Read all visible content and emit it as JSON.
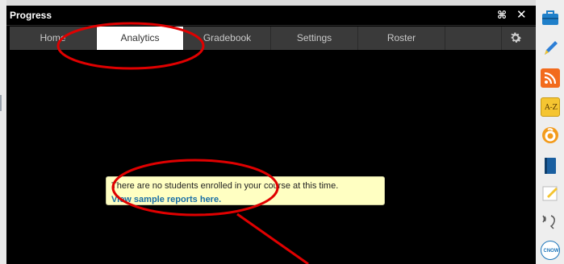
{
  "window": {
    "title": "Progress",
    "collapse_icon": "collapse-icon",
    "close_icon": "close-icon"
  },
  "tabs": [
    {
      "label": "Home",
      "active": false
    },
    {
      "label": "Analytics",
      "active": true
    },
    {
      "label": "Gradebook",
      "active": false
    },
    {
      "label": "Settings",
      "active": false
    },
    {
      "label": "Roster",
      "active": false
    }
  ],
  "notice": {
    "message": "There are no students enrolled in your course at this time.",
    "link": "View sample reports here."
  },
  "dock": {
    "az_label": "A-Z",
    "cnow_label": "CNOW",
    "icons": [
      "briefcase-icon",
      "pencil-icon",
      "rss-icon",
      "az-dictionary-icon",
      "o-app-icon",
      "book-icon",
      "note-icon",
      "audio-speaker-icon",
      "cnow-icon"
    ]
  },
  "colors": {
    "accent_link": "#1a6fa6",
    "notice_bg": "#ffffc2",
    "annotation": "#e00000",
    "tab_active_bg": "#ffffff",
    "tab_bar_bg": "#3a3a3a"
  }
}
